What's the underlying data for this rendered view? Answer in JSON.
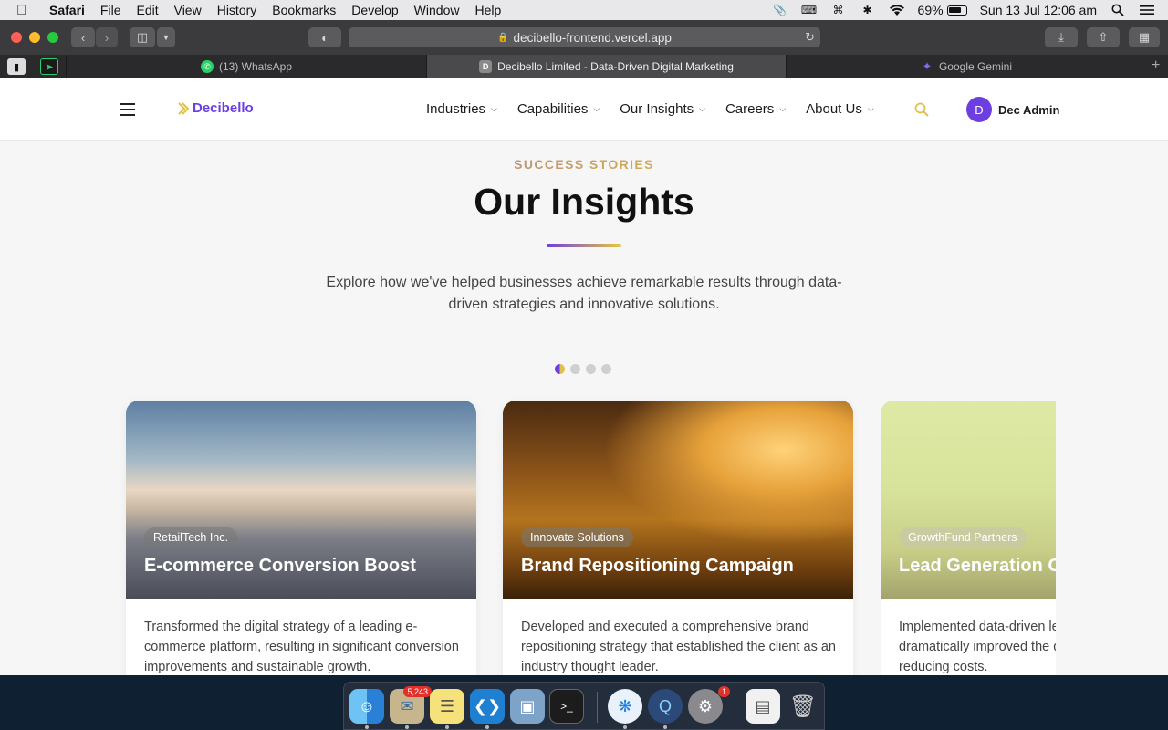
{
  "menubar": {
    "app_name": "Safari",
    "items": [
      "File",
      "Edit",
      "View",
      "History",
      "Bookmarks",
      "Develop",
      "Window",
      "Help"
    ],
    "battery": "69%",
    "datetime": "Sun 13 Jul  12:06 am"
  },
  "browser": {
    "url": "decibello-frontend.vercel.app",
    "tabs": [
      {
        "label": "(13) WhatsApp",
        "icon": "whatsapp-icon"
      },
      {
        "label": "Decibello Limited - Data-Driven Digital Marketing",
        "icon_letter": "D"
      },
      {
        "label": "Google Gemini",
        "icon": "gemini-icon"
      }
    ]
  },
  "site": {
    "logo": "Decibello",
    "nav": [
      "Industries",
      "Capabilities",
      "Our Insights",
      "Careers",
      "About Us"
    ],
    "user": {
      "initial": "D",
      "name": "Dec Admin"
    }
  },
  "hero": {
    "eyebrow": "SUCCESS STORIES",
    "title": "Our Insights",
    "lede": "Explore how we've helped businesses achieve remarkable results through data-driven strategies and innovative solutions."
  },
  "cards": [
    {
      "client": "RetailTech Inc.",
      "title": "E-commerce Conversion Boost",
      "description": "Transformed the digital strategy of a leading e-commerce platform, resulting in significant conversion improvements and sustainable growth."
    },
    {
      "client": "Innovate Solutions",
      "title": "Brand Repositioning Campaign",
      "description": "Developed and executed a comprehensive brand repositioning strategy that established the client as an industry thought leader."
    },
    {
      "client": "GrowthFund Partners",
      "title": "Lead Generation Optimization",
      "description": "Implemented data-driven lead strategies that dramatically improved the quantity of leads while reducing costs."
    }
  ],
  "dock": {
    "mail_badge": "5,243",
    "prefs_badge": "1"
  },
  "colors": {
    "brand_purple": "#6d3fe0",
    "brand_gold": "#e0c04a"
  }
}
